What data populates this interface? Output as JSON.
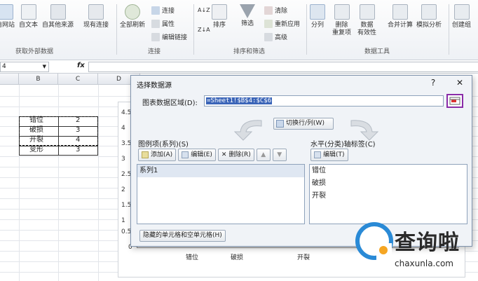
{
  "ribbon": {
    "external_data": {
      "items": [
        "自网站",
        "自文本",
        "自其他来源",
        "现有连接"
      ],
      "group_label": "获取外部数据"
    },
    "connections": {
      "refresh_label": "全部刷新",
      "items": [
        "连接",
        "属性",
        "编辑链接"
      ],
      "group_label": "连接"
    },
    "sort_filter": {
      "sort_label": "排序",
      "filter_label": "筛选",
      "items": [
        "清除",
        "重新应用",
        "高级"
      ],
      "group_label": "排序和筛选"
    },
    "data_tools": {
      "items": [
        "分列",
        "删除\n重复项",
        "数据\n有效性",
        "合并计算",
        "模拟分析"
      ],
      "group_label": "数据工具"
    },
    "outline": {
      "items": [
        "创建组"
      ]
    }
  },
  "formula_bar": {
    "name_box": "4",
    "fx": "fx"
  },
  "sheet": {
    "columns": [
      "B",
      "C",
      "D"
    ],
    "rows": [
      {
        "b": "错位",
        "c": "2"
      },
      {
        "b": "破损",
        "c": "3"
      },
      {
        "b": "开裂",
        "c": "4"
      },
      {
        "b": "变形",
        "c": "3"
      }
    ]
  },
  "chart": {
    "y_ticks": [
      "4.5",
      "4",
      "3.5",
      "3",
      "2.5",
      "2",
      "1.5",
      "1",
      "0.5",
      "0"
    ],
    "categories": [
      "错位",
      "破损",
      "开裂"
    ]
  },
  "dialog": {
    "title": "选择数据源",
    "help": "?",
    "close": "✕",
    "range_label": "图表数据区域(D):",
    "range_value": "=Sheet1!$B$4:$C$6",
    "switch_label": "切换行/列(W)",
    "legend_label": "图例项(系列)(S)",
    "legend_buttons": {
      "add": "添加(A)",
      "edit": "编辑(E)",
      "remove": "删除(R)"
    },
    "series": [
      "系列1"
    ],
    "axis_label": "水平(分类)轴标签(C)",
    "axis_edit": "编辑(T)",
    "axis_items": [
      "错位",
      "破损",
      "开裂"
    ],
    "hidden_cells_label": "隐藏的单元格和空单元格(H)"
  },
  "watermark": {
    "text": "查询啦",
    "url": "chaxunla.com"
  },
  "colors": {
    "accent": "#3a64b8",
    "highlight_border": "#8a2ca8",
    "watermark_c": "#2a8ad6",
    "watermark_dot": "#f5a623"
  }
}
